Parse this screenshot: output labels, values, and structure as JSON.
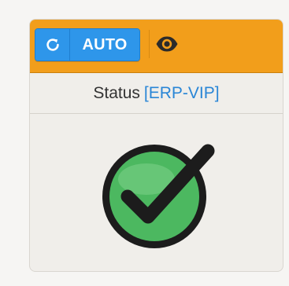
{
  "toolbar": {
    "refresh_icon": "refresh-icon",
    "auto_label": "AUTO",
    "eye_icon": "eye-icon",
    "background_color": "#f29e1b",
    "button_color": "#2e96ea"
  },
  "status": {
    "label": "Status",
    "open_bracket": "[",
    "name": "ERP-VIP",
    "close_bracket": "]",
    "name_color": "#2a86d6",
    "indicator_icon": "check-circle-icon",
    "indicator_color": "#4cb860",
    "state": "ok"
  }
}
